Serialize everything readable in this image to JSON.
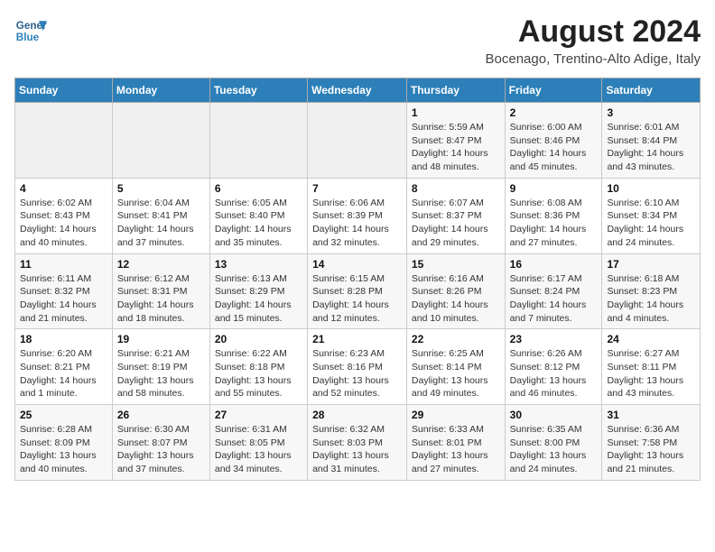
{
  "logo": {
    "line1": "General",
    "line2": "Blue"
  },
  "title": "August 2024",
  "subtitle": "Bocenago, Trentino-Alto Adige, Italy",
  "weekdays": [
    "Sunday",
    "Monday",
    "Tuesday",
    "Wednesday",
    "Thursday",
    "Friday",
    "Saturday"
  ],
  "weeks": [
    [
      {
        "day": "",
        "detail": ""
      },
      {
        "day": "",
        "detail": ""
      },
      {
        "day": "",
        "detail": ""
      },
      {
        "day": "",
        "detail": ""
      },
      {
        "day": "1",
        "detail": "Sunrise: 5:59 AM\nSunset: 8:47 PM\nDaylight: 14 hours\nand 48 minutes."
      },
      {
        "day": "2",
        "detail": "Sunrise: 6:00 AM\nSunset: 8:46 PM\nDaylight: 14 hours\nand 45 minutes."
      },
      {
        "day": "3",
        "detail": "Sunrise: 6:01 AM\nSunset: 8:44 PM\nDaylight: 14 hours\nand 43 minutes."
      }
    ],
    [
      {
        "day": "4",
        "detail": "Sunrise: 6:02 AM\nSunset: 8:43 PM\nDaylight: 14 hours\nand 40 minutes."
      },
      {
        "day": "5",
        "detail": "Sunrise: 6:04 AM\nSunset: 8:41 PM\nDaylight: 14 hours\nand 37 minutes."
      },
      {
        "day": "6",
        "detail": "Sunrise: 6:05 AM\nSunset: 8:40 PM\nDaylight: 14 hours\nand 35 minutes."
      },
      {
        "day": "7",
        "detail": "Sunrise: 6:06 AM\nSunset: 8:39 PM\nDaylight: 14 hours\nand 32 minutes."
      },
      {
        "day": "8",
        "detail": "Sunrise: 6:07 AM\nSunset: 8:37 PM\nDaylight: 14 hours\nand 29 minutes."
      },
      {
        "day": "9",
        "detail": "Sunrise: 6:08 AM\nSunset: 8:36 PM\nDaylight: 14 hours\nand 27 minutes."
      },
      {
        "day": "10",
        "detail": "Sunrise: 6:10 AM\nSunset: 8:34 PM\nDaylight: 14 hours\nand 24 minutes."
      }
    ],
    [
      {
        "day": "11",
        "detail": "Sunrise: 6:11 AM\nSunset: 8:32 PM\nDaylight: 14 hours\nand 21 minutes."
      },
      {
        "day": "12",
        "detail": "Sunrise: 6:12 AM\nSunset: 8:31 PM\nDaylight: 14 hours\nand 18 minutes."
      },
      {
        "day": "13",
        "detail": "Sunrise: 6:13 AM\nSunset: 8:29 PM\nDaylight: 14 hours\nand 15 minutes."
      },
      {
        "day": "14",
        "detail": "Sunrise: 6:15 AM\nSunset: 8:28 PM\nDaylight: 14 hours\nand 12 minutes."
      },
      {
        "day": "15",
        "detail": "Sunrise: 6:16 AM\nSunset: 8:26 PM\nDaylight: 14 hours\nand 10 minutes."
      },
      {
        "day": "16",
        "detail": "Sunrise: 6:17 AM\nSunset: 8:24 PM\nDaylight: 14 hours\nand 7 minutes."
      },
      {
        "day": "17",
        "detail": "Sunrise: 6:18 AM\nSunset: 8:23 PM\nDaylight: 14 hours\nand 4 minutes."
      }
    ],
    [
      {
        "day": "18",
        "detail": "Sunrise: 6:20 AM\nSunset: 8:21 PM\nDaylight: 14 hours\nand 1 minute."
      },
      {
        "day": "19",
        "detail": "Sunrise: 6:21 AM\nSunset: 8:19 PM\nDaylight: 13 hours\nand 58 minutes."
      },
      {
        "day": "20",
        "detail": "Sunrise: 6:22 AM\nSunset: 8:18 PM\nDaylight: 13 hours\nand 55 minutes."
      },
      {
        "day": "21",
        "detail": "Sunrise: 6:23 AM\nSunset: 8:16 PM\nDaylight: 13 hours\nand 52 minutes."
      },
      {
        "day": "22",
        "detail": "Sunrise: 6:25 AM\nSunset: 8:14 PM\nDaylight: 13 hours\nand 49 minutes."
      },
      {
        "day": "23",
        "detail": "Sunrise: 6:26 AM\nSunset: 8:12 PM\nDaylight: 13 hours\nand 46 minutes."
      },
      {
        "day": "24",
        "detail": "Sunrise: 6:27 AM\nSunset: 8:11 PM\nDaylight: 13 hours\nand 43 minutes."
      }
    ],
    [
      {
        "day": "25",
        "detail": "Sunrise: 6:28 AM\nSunset: 8:09 PM\nDaylight: 13 hours\nand 40 minutes."
      },
      {
        "day": "26",
        "detail": "Sunrise: 6:30 AM\nSunset: 8:07 PM\nDaylight: 13 hours\nand 37 minutes."
      },
      {
        "day": "27",
        "detail": "Sunrise: 6:31 AM\nSunset: 8:05 PM\nDaylight: 13 hours\nand 34 minutes."
      },
      {
        "day": "28",
        "detail": "Sunrise: 6:32 AM\nSunset: 8:03 PM\nDaylight: 13 hours\nand 31 minutes."
      },
      {
        "day": "29",
        "detail": "Sunrise: 6:33 AM\nSunset: 8:01 PM\nDaylight: 13 hours\nand 27 minutes."
      },
      {
        "day": "30",
        "detail": "Sunrise: 6:35 AM\nSunset: 8:00 PM\nDaylight: 13 hours\nand 24 minutes."
      },
      {
        "day": "31",
        "detail": "Sunrise: 6:36 AM\nSunset: 7:58 PM\nDaylight: 13 hours\nand 21 minutes."
      }
    ]
  ]
}
